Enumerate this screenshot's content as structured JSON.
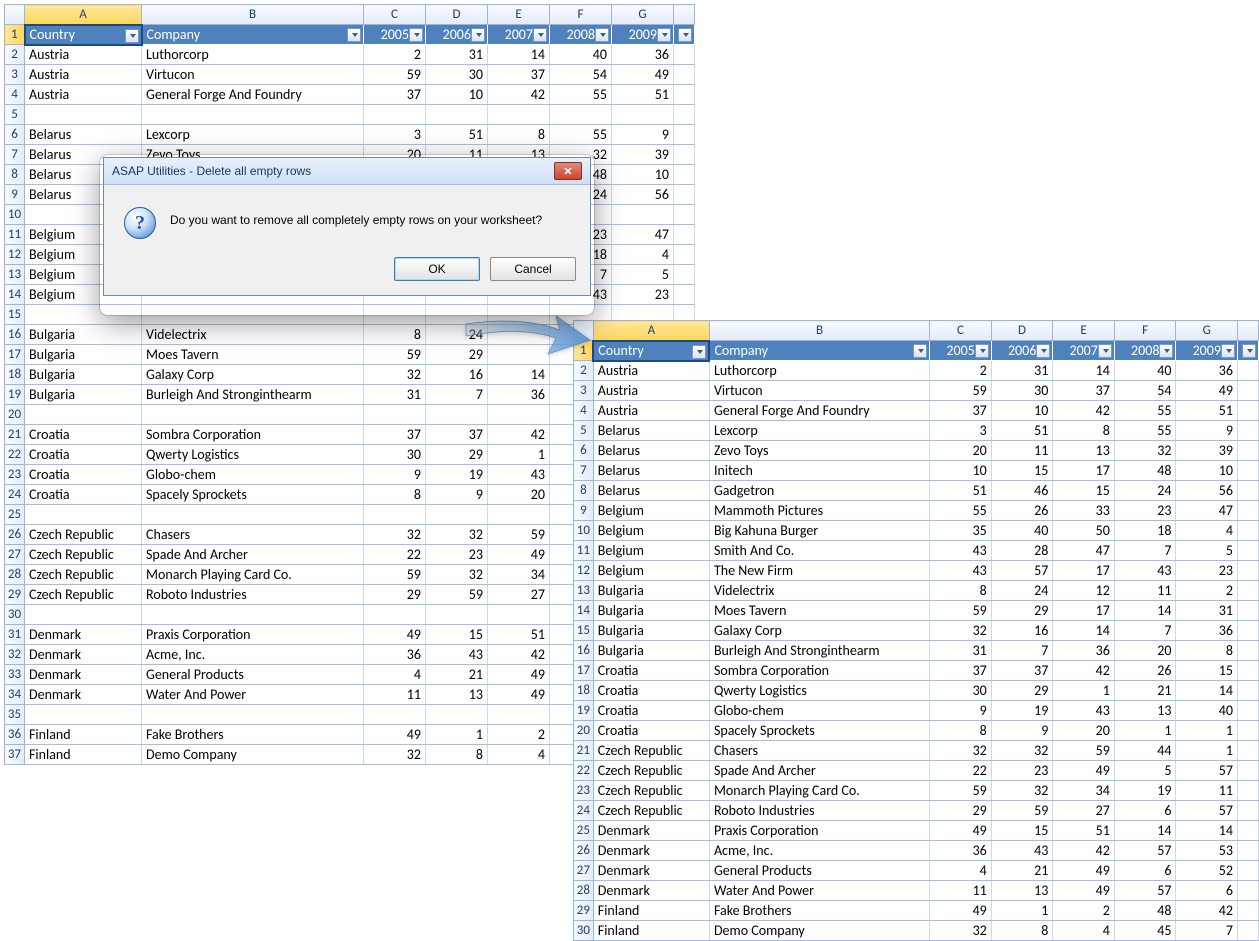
{
  "dialog": {
    "title": "ASAP Utilities - Delete all empty rows",
    "message": "Do you want to remove all completely empty rows on your worksheet?",
    "ok": "OK",
    "cancel": "Cancel",
    "close_glyph": "✕"
  },
  "left": {
    "cols": [
      "A",
      "B",
      "C",
      "D",
      "E",
      "F",
      "G"
    ],
    "header": [
      "Country",
      "Company",
      "2005",
      "2006",
      "2007",
      "2008",
      "2009"
    ],
    "rows": [
      {
        "n": 2,
        "d": [
          "Austria",
          "Luthorcorp",
          "2",
          "31",
          "14",
          "40",
          "36"
        ]
      },
      {
        "n": 3,
        "d": [
          "Austria",
          "Virtucon",
          "59",
          "30",
          "37",
          "54",
          "49"
        ]
      },
      {
        "n": 4,
        "d": [
          "Austria",
          "General Forge And Foundry",
          "37",
          "10",
          "42",
          "55",
          "51"
        ]
      },
      {
        "n": 5,
        "d": [
          "",
          "",
          "",
          "",
          "",
          "",
          ""
        ]
      },
      {
        "n": 6,
        "d": [
          "Belarus",
          "Lexcorp",
          "3",
          "51",
          "8",
          "55",
          "9"
        ]
      },
      {
        "n": 7,
        "d": [
          "Belarus",
          "Zevo Toys",
          "20",
          "11",
          "13",
          "32",
          "39"
        ]
      },
      {
        "n": 8,
        "d": [
          "Belarus",
          "",
          "",
          "",
          "",
          "48",
          "10"
        ]
      },
      {
        "n": 9,
        "d": [
          "Belarus",
          "",
          "",
          "",
          "",
          "24",
          "56"
        ]
      },
      {
        "n": 10,
        "d": [
          "",
          "",
          "",
          "",
          "",
          "",
          ""
        ]
      },
      {
        "n": 11,
        "d": [
          "Belgium",
          "",
          "",
          "",
          "",
          "23",
          "47"
        ]
      },
      {
        "n": 12,
        "d": [
          "Belgium",
          "",
          "",
          "",
          "",
          "18",
          "4"
        ]
      },
      {
        "n": 13,
        "d": [
          "Belgium",
          "",
          "",
          "",
          "",
          "7",
          "5"
        ]
      },
      {
        "n": 14,
        "d": [
          "Belgium",
          "",
          "",
          "",
          "",
          "43",
          "23"
        ]
      },
      {
        "n": 15,
        "d": [
          "",
          "",
          "",
          "",
          "",
          "",
          ""
        ]
      },
      {
        "n": 16,
        "d": [
          "Bulgaria",
          "Videlectrix",
          "8",
          "24",
          "",
          "",
          ""
        ]
      },
      {
        "n": 17,
        "d": [
          "Bulgaria",
          "Moes Tavern",
          "59",
          "29",
          "",
          "",
          ""
        ]
      },
      {
        "n": 18,
        "d": [
          "Bulgaria",
          "Galaxy Corp",
          "32",
          "16",
          "14",
          "",
          ""
        ]
      },
      {
        "n": 19,
        "d": [
          "Bulgaria",
          "Burleigh And Stronginthearm",
          "31",
          "7",
          "36",
          "",
          ""
        ]
      },
      {
        "n": 20,
        "d": [
          "",
          "",
          "",
          "",
          "",
          "",
          ""
        ]
      },
      {
        "n": 21,
        "d": [
          "Croatia",
          "Sombra Corporation",
          "37",
          "37",
          "42",
          "",
          ""
        ]
      },
      {
        "n": 22,
        "d": [
          "Croatia",
          "Qwerty Logistics",
          "30",
          "29",
          "1",
          "",
          ""
        ]
      },
      {
        "n": 23,
        "d": [
          "Croatia",
          "Globo-chem",
          "9",
          "19",
          "43",
          "",
          ""
        ]
      },
      {
        "n": 24,
        "d": [
          "Croatia",
          "Spacely Sprockets",
          "8",
          "9",
          "20",
          "",
          ""
        ]
      },
      {
        "n": 25,
        "d": [
          "",
          "",
          "",
          "",
          "",
          "",
          ""
        ]
      },
      {
        "n": 26,
        "d": [
          "Czech Republic",
          "Chasers",
          "32",
          "32",
          "59",
          "",
          ""
        ]
      },
      {
        "n": 27,
        "d": [
          "Czech Republic",
          "Spade And Archer",
          "22",
          "23",
          "49",
          "",
          ""
        ]
      },
      {
        "n": 28,
        "d": [
          "Czech Republic",
          "Monarch Playing Card Co.",
          "59",
          "32",
          "34",
          "",
          ""
        ]
      },
      {
        "n": 29,
        "d": [
          "Czech Republic",
          "Roboto Industries",
          "29",
          "59",
          "27",
          "",
          ""
        ]
      },
      {
        "n": 30,
        "d": [
          "",
          "",
          "",
          "",
          "",
          "",
          ""
        ]
      },
      {
        "n": 31,
        "d": [
          "Denmark",
          "Praxis Corporation",
          "49",
          "15",
          "51",
          "",
          ""
        ]
      },
      {
        "n": 32,
        "d": [
          "Denmark",
          "Acme, Inc.",
          "36",
          "43",
          "42",
          "",
          ""
        ]
      },
      {
        "n": 33,
        "d": [
          "Denmark",
          "General Products",
          "4",
          "21",
          "49",
          "",
          ""
        ]
      },
      {
        "n": 34,
        "d": [
          "Denmark",
          "Water And Power",
          "11",
          "13",
          "49",
          "",
          ""
        ]
      },
      {
        "n": 35,
        "d": [
          "",
          "",
          "",
          "",
          "",
          "",
          ""
        ]
      },
      {
        "n": 36,
        "d": [
          "Finland",
          "Fake Brothers",
          "49",
          "1",
          "2",
          "",
          ""
        ]
      },
      {
        "n": 37,
        "d": [
          "Finland",
          "Demo Company",
          "32",
          "8",
          "4",
          "",
          ""
        ]
      }
    ]
  },
  "right": {
    "cols": [
      "A",
      "B",
      "C",
      "D",
      "E",
      "F",
      "G"
    ],
    "header": [
      "Country",
      "Company",
      "2005",
      "2006",
      "2007",
      "2008",
      "2009"
    ],
    "rows": [
      {
        "n": 2,
        "d": [
          "Austria",
          "Luthorcorp",
          "2",
          "31",
          "14",
          "40",
          "36"
        ]
      },
      {
        "n": 3,
        "d": [
          "Austria",
          "Virtucon",
          "59",
          "30",
          "37",
          "54",
          "49"
        ]
      },
      {
        "n": 4,
        "d": [
          "Austria",
          "General Forge And Foundry",
          "37",
          "10",
          "42",
          "55",
          "51"
        ]
      },
      {
        "n": 5,
        "d": [
          "Belarus",
          "Lexcorp",
          "3",
          "51",
          "8",
          "55",
          "9"
        ]
      },
      {
        "n": 6,
        "d": [
          "Belarus",
          "Zevo Toys",
          "20",
          "11",
          "13",
          "32",
          "39"
        ]
      },
      {
        "n": 7,
        "d": [
          "Belarus",
          "Initech",
          "10",
          "15",
          "17",
          "48",
          "10"
        ]
      },
      {
        "n": 8,
        "d": [
          "Belarus",
          "Gadgetron",
          "51",
          "46",
          "15",
          "24",
          "56"
        ]
      },
      {
        "n": 9,
        "d": [
          "Belgium",
          "Mammoth Pictures",
          "55",
          "26",
          "33",
          "23",
          "47"
        ]
      },
      {
        "n": 10,
        "d": [
          "Belgium",
          "Big Kahuna Burger",
          "35",
          "40",
          "50",
          "18",
          "4"
        ]
      },
      {
        "n": 11,
        "d": [
          "Belgium",
          "Smith And Co.",
          "43",
          "28",
          "47",
          "7",
          "5"
        ]
      },
      {
        "n": 12,
        "d": [
          "Belgium",
          "The New Firm",
          "43",
          "57",
          "17",
          "43",
          "23"
        ]
      },
      {
        "n": 13,
        "d": [
          "Bulgaria",
          "Videlectrix",
          "8",
          "24",
          "12",
          "11",
          "2"
        ]
      },
      {
        "n": 14,
        "d": [
          "Bulgaria",
          "Moes Tavern",
          "59",
          "29",
          "17",
          "14",
          "31"
        ]
      },
      {
        "n": 15,
        "d": [
          "Bulgaria",
          "Galaxy Corp",
          "32",
          "16",
          "14",
          "7",
          "36"
        ]
      },
      {
        "n": 16,
        "d": [
          "Bulgaria",
          "Burleigh And Stronginthearm",
          "31",
          "7",
          "36",
          "20",
          "8"
        ]
      },
      {
        "n": 17,
        "d": [
          "Croatia",
          "Sombra Corporation",
          "37",
          "37",
          "42",
          "26",
          "15"
        ]
      },
      {
        "n": 18,
        "d": [
          "Croatia",
          "Qwerty Logistics",
          "30",
          "29",
          "1",
          "21",
          "14"
        ]
      },
      {
        "n": 19,
        "d": [
          "Croatia",
          "Globo-chem",
          "9",
          "19",
          "43",
          "13",
          "40"
        ]
      },
      {
        "n": 20,
        "d": [
          "Croatia",
          "Spacely Sprockets",
          "8",
          "9",
          "20",
          "1",
          "1"
        ]
      },
      {
        "n": 21,
        "d": [
          "Czech Republic",
          "Chasers",
          "32",
          "32",
          "59",
          "44",
          "1"
        ]
      },
      {
        "n": 22,
        "d": [
          "Czech Republic",
          "Spade And Archer",
          "22",
          "23",
          "49",
          "5",
          "57"
        ]
      },
      {
        "n": 23,
        "d": [
          "Czech Republic",
          "Monarch Playing Card Co.",
          "59",
          "32",
          "34",
          "19",
          "11"
        ]
      },
      {
        "n": 24,
        "d": [
          "Czech Republic",
          "Roboto Industries",
          "29",
          "59",
          "27",
          "6",
          "57"
        ]
      },
      {
        "n": 25,
        "d": [
          "Denmark",
          "Praxis Corporation",
          "49",
          "15",
          "51",
          "14",
          "14"
        ]
      },
      {
        "n": 26,
        "d": [
          "Denmark",
          "Acme, Inc.",
          "36",
          "43",
          "42",
          "57",
          "53"
        ]
      },
      {
        "n": 27,
        "d": [
          "Denmark",
          "General Products",
          "4",
          "21",
          "49",
          "6",
          "52"
        ]
      },
      {
        "n": 28,
        "d": [
          "Denmark",
          "Water And Power",
          "11",
          "13",
          "49",
          "57",
          "6"
        ]
      },
      {
        "n": 29,
        "d": [
          "Finland",
          "Fake Brothers",
          "49",
          "1",
          "2",
          "48",
          "42"
        ]
      },
      {
        "n": 30,
        "d": [
          "Finland",
          "Demo Company",
          "32",
          "8",
          "4",
          "45",
          "7"
        ]
      }
    ]
  }
}
